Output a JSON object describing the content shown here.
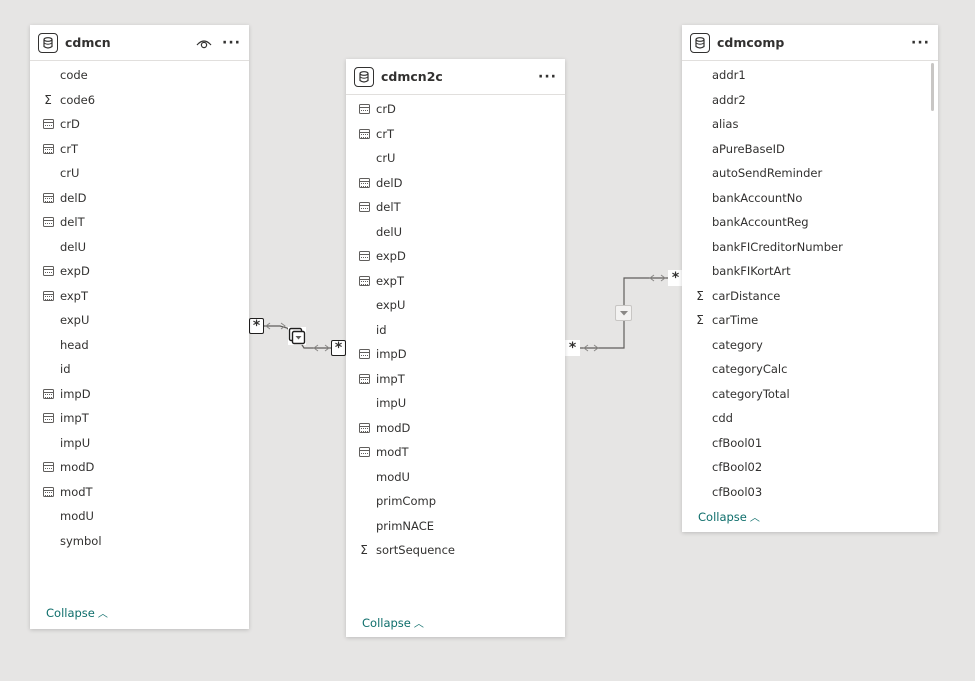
{
  "tables": [
    {
      "title": "cdmcn",
      "collapse_label": "Collapse",
      "fields": [
        {
          "name": "code",
          "icon": "none"
        },
        {
          "name": "code6",
          "icon": "sigma"
        },
        {
          "name": "crD",
          "icon": "calendar"
        },
        {
          "name": "crT",
          "icon": "calendar"
        },
        {
          "name": "crU",
          "icon": "none"
        },
        {
          "name": "delD",
          "icon": "calendar"
        },
        {
          "name": "delT",
          "icon": "calendar"
        },
        {
          "name": "delU",
          "icon": "none"
        },
        {
          "name": "expD",
          "icon": "calendar"
        },
        {
          "name": "expT",
          "icon": "calendar"
        },
        {
          "name": "expU",
          "icon": "none"
        },
        {
          "name": "head",
          "icon": "none"
        },
        {
          "name": "id",
          "icon": "none"
        },
        {
          "name": "impD",
          "icon": "calendar"
        },
        {
          "name": "impT",
          "icon": "calendar"
        },
        {
          "name": "impU",
          "icon": "none"
        },
        {
          "name": "modD",
          "icon": "calendar"
        },
        {
          "name": "modT",
          "icon": "calendar"
        },
        {
          "name": "modU",
          "icon": "none"
        },
        {
          "name": "symbol",
          "icon": "none"
        }
      ]
    },
    {
      "title": "cdmcn2c",
      "collapse_label": "Collapse",
      "fields": [
        {
          "name": "crD",
          "icon": "calendar"
        },
        {
          "name": "crT",
          "icon": "calendar"
        },
        {
          "name": "crU",
          "icon": "none"
        },
        {
          "name": "delD",
          "icon": "calendar"
        },
        {
          "name": "delT",
          "icon": "calendar"
        },
        {
          "name": "delU",
          "icon": "none"
        },
        {
          "name": "expD",
          "icon": "calendar"
        },
        {
          "name": "expT",
          "icon": "calendar"
        },
        {
          "name": "expU",
          "icon": "none"
        },
        {
          "name": "id",
          "icon": "none"
        },
        {
          "name": "impD",
          "icon": "calendar"
        },
        {
          "name": "impT",
          "icon": "calendar"
        },
        {
          "name": "impU",
          "icon": "none"
        },
        {
          "name": "modD",
          "icon": "calendar"
        },
        {
          "name": "modT",
          "icon": "calendar"
        },
        {
          "name": "modU",
          "icon": "none"
        },
        {
          "name": "primComp",
          "icon": "none"
        },
        {
          "name": "primNACE",
          "icon": "none"
        },
        {
          "name": "sortSequence",
          "icon": "sigma"
        }
      ]
    },
    {
      "title": "cdmcomp",
      "collapse_label": "Collapse",
      "fields": [
        {
          "name": "addr1",
          "icon": "none"
        },
        {
          "name": "addr2",
          "icon": "none"
        },
        {
          "name": "alias",
          "icon": "none"
        },
        {
          "name": "aPureBaseID",
          "icon": "none"
        },
        {
          "name": "autoSendReminder",
          "icon": "none"
        },
        {
          "name": "bankAccountNo",
          "icon": "none"
        },
        {
          "name": "bankAccountReg",
          "icon": "none"
        },
        {
          "name": "bankFICreditorNumber",
          "icon": "none"
        },
        {
          "name": "bankFIKortArt",
          "icon": "none"
        },
        {
          "name": "carDistance",
          "icon": "sigma"
        },
        {
          "name": "carTime",
          "icon": "sigma"
        },
        {
          "name": "category",
          "icon": "none"
        },
        {
          "name": "categoryCalc",
          "icon": "none"
        },
        {
          "name": "categoryTotal",
          "icon": "none"
        },
        {
          "name": "cdd",
          "icon": "none"
        },
        {
          "name": "cfBool01",
          "icon": "none"
        },
        {
          "name": "cfBool02",
          "icon": "none"
        },
        {
          "name": "cfBool03",
          "icon": "none"
        }
      ]
    }
  ],
  "relationships": [
    {
      "from_cardinality": "*",
      "to_cardinality": "*",
      "filter_direction": "both"
    },
    {
      "from_cardinality": "*",
      "to_cardinality": "*",
      "filter_direction": "single"
    }
  ],
  "icons": {
    "table": "database-icon",
    "visibility": "eye-icon",
    "more": "more-options-icon"
  },
  "colors": {
    "canvas": "#e6e5e4",
    "card": "#ffffff",
    "link": "#0e6e6b",
    "line": "#605e5c"
  }
}
